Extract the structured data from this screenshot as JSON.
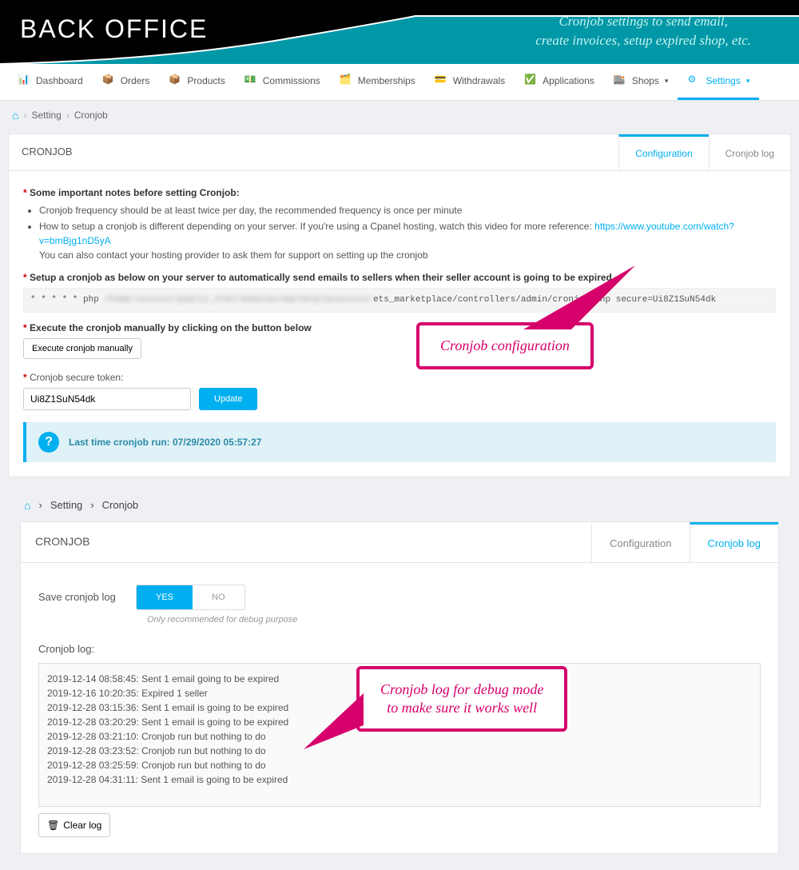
{
  "banner": {
    "title": "BACK OFFICE",
    "subtitle_l1": "Cronjob settings to send email,",
    "subtitle_l2": "create invoices, setup expired shop, etc."
  },
  "nav": {
    "dashboard": "Dashboard",
    "orders": "Orders",
    "products": "Products",
    "commissions": "Commissions",
    "memberships": "Memberships",
    "withdrawals": "Withdrawals",
    "applications": "Applications",
    "shops": "Shops",
    "settings": "Settings"
  },
  "breadcrumb": {
    "setting": "Setting",
    "cronjob": "Cronjob"
  },
  "panel1": {
    "title": "CRONJOB",
    "tab_config": "Configuration",
    "tab_log": "Cronjob log",
    "notes_label": "Some important notes before setting Cronjob:",
    "note1": "Cronjob frequency should be at least twice per day, the recommended frequency is once per minute",
    "note2a": "How to setup a cronjob is different depending on your server. If you're using a Cpanel hosting, watch this video for more reference: ",
    "note2_link": "https://www.youtube.com/watch?v=bmBjg1nD5yA",
    "note2b": "You can also contact your hosting provider to ask them for support on setting up the cronjob",
    "setup_label": "Setup a cronjob as below on your server to automatically send emails to sellers when their seller account is going to be expired.",
    "code_prefix": "* * * * * php ",
    "code_blur": "/home/xxxxxxx/public_html/modules/marketplacexxxxx/",
    "code_suffix": "ets_marketplace/controllers/admin/cronjob.php secure=Ui8Z1SuN54dk",
    "exec_label": "Execute the cronjob manually by clicking on the button below",
    "exec_btn": "Execute cronjob manually",
    "token_label": "Cronjob secure token:",
    "token_value": "Ui8Z1SuN54dk",
    "update_btn": "Update",
    "info_text": "Last time cronjob run: 07/29/2020 05:57:27"
  },
  "callout1": "Cronjob configuration",
  "panel2": {
    "title": "CRONJOB",
    "tab_config": "Configuration",
    "tab_log": "Cronjob log",
    "save_label": "Save cronjob log",
    "yes": "YES",
    "no": "NO",
    "hint": "Only recommended for debug purpose",
    "log_label": "Cronjob log:",
    "logs": [
      "2019-12-14 08:58:45: Sent 1 email going to be expired",
      "2019-12-16 10:20:35: Expired 1 seller",
      "2019-12-28 03:15:36: Sent 1 email is going to be expired",
      "2019-12-28 03:20:29: Sent 1 email is going to be expired",
      "2019-12-28 03:21:10: Cronjob run but nothing to do",
      "2019-12-28 03:23:52: Cronjob run but nothing to do",
      "2019-12-28 03:25:59: Cronjob run but nothing to do",
      "2019-12-28 04:31:11: Sent 1 email is going to be expired"
    ],
    "clear_btn": "Clear log"
  },
  "callout2_l1": "Cronjob log for debug mode",
  "callout2_l2": "to make sure it works well"
}
